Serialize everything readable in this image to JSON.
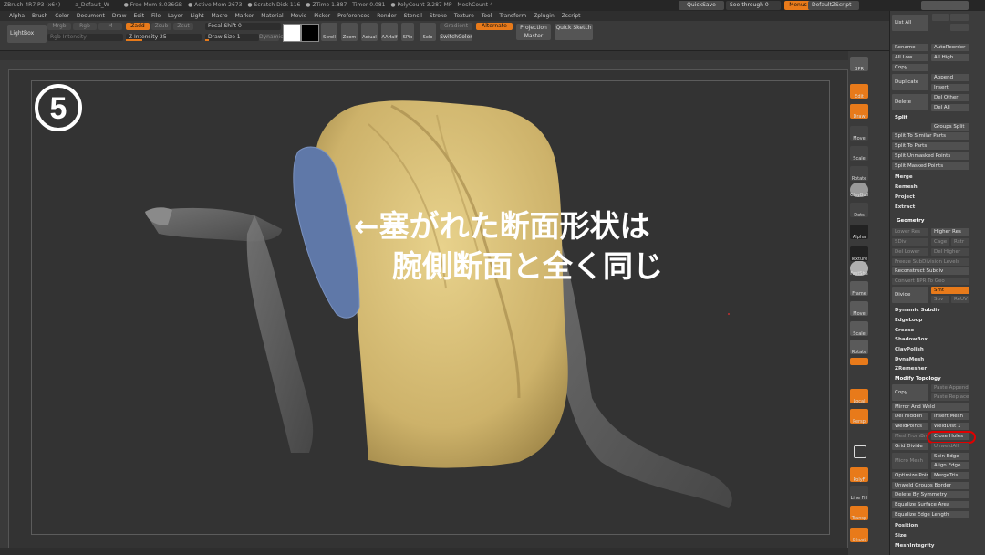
{
  "titlebar": {
    "app": "ZBrush 4R7 P3 (x64)",
    "doc": "a_Default_W",
    "free_mem": "● Free Mem 8.036GB",
    "active_mem": "● Active Mem 2673",
    "scratch": "● Scratch Disk 116",
    "ztime": "● ZTime 1.887",
    "timer": "Timer 0.081",
    "polycount": "● PolyCount 3.287 MP",
    "meshcount": "MeshCount 4",
    "quicksave": "QuickSave",
    "seethrough": "See-through 0",
    "menus": "Menus",
    "script": "DefaultZScript"
  },
  "menus": [
    "Alpha",
    "Brush",
    "Color",
    "Document",
    "Draw",
    "Edit",
    "File",
    "Layer",
    "Light",
    "Macro",
    "Marker",
    "Material",
    "Movie",
    "Picker",
    "Preferences",
    "Render",
    "Stencil",
    "Stroke",
    "Texture",
    "Tool",
    "Transform",
    "Zplugin",
    "Zscript"
  ],
  "toolbar": {
    "lightbox": "LightBox",
    "mrgb": "Mrgb",
    "rgb": "Rgb",
    "m": "M",
    "zadd": "Zadd",
    "zsub": "Zsub",
    "zcut": "Zcut",
    "rgb_intensity": "Rgb Intensity",
    "z_intensity": "Z Intensity 25",
    "focal_shift": "Focal Shift 0",
    "draw_size": "Draw Size 1",
    "dynamic": "Dynamic",
    "scroll": "Scroll",
    "zoom": "Zoom",
    "actual": "Actual",
    "aahalf": "AAHalf",
    "spix": "SPix",
    "gradient": "Gradient",
    "switchcolor": "SwitchColor",
    "alternate": "Alternate",
    "projection_master": "Projection Master",
    "quick_sketch": "Quick Sketch"
  },
  "canvas": {
    "step_number": "⑤",
    "caption_line1": "←塞がれた断面形状は",
    "caption_line2": "腕側断面と全く同じ"
  },
  "right_shelf": {
    "bpr": "BPR",
    "spix": "SPix 3",
    "edit": "Edit",
    "draw": "Draw",
    "move": "Move",
    "scale": "Scale",
    "rotate": "Rotate",
    "claybuild": "ClayBuil",
    "dots": "Dots",
    "alpha_off": "Alpha Off",
    "texture_off": "Texture Off",
    "fastshader": "FastSha",
    "frame": "Frame",
    "move2": "Move",
    "scale2": "Scale",
    "rotate2": "Rotate",
    "linefill": "Line Fill",
    "polyf": "PolyF",
    "local": "Local",
    "persp": "Persp",
    "floor": "Floor",
    "transp": "Transp",
    "ghost": "Ghost",
    "xyz": "Xyz",
    "solo": "Solo",
    "react": "React"
  },
  "palette": {
    "list_all": "List All",
    "rename": "Rename",
    "autoreorder": "AutoReorder",
    "all_low": "All Low",
    "all_high": "All High",
    "copy": "Copy",
    "duplicate": "Duplicate",
    "append": "Append",
    "insert": "Insert",
    "delete": "Delete",
    "del_other": "Del Other",
    "del_all": "Del All",
    "split": "Split",
    "groups_split": "Groups Split",
    "split_similar": "Split To Similar Parts",
    "split_parts": "Split To Parts",
    "split_unmasked": "Split Unmasked Points",
    "split_masked": "Split Masked Points",
    "merge": "Merge",
    "remesh": "Remesh",
    "project": "Project",
    "extract": "Extract",
    "geometry": "Geometry",
    "lower_res": "Lower Res",
    "higher_res": "Higher Res",
    "sdiv": "SDiv",
    "cage": "Cage",
    "rstr": "Rstr",
    "del_lower": "Del Lower",
    "del_higher": "Del Higher",
    "freeze_subdiv": "Freeze SubDivision Levels",
    "reconstruct": "Reconstruct Subdiv",
    "convert_bpr": "Convert BPR To Geo",
    "divide": "Divide",
    "smt": "Smt",
    "suv": "Suv",
    "reuv": "ReUV",
    "dynamic_subdiv": "Dynamic Subdiv",
    "edgeloop": "EdgeLoop",
    "crease": "Crease",
    "shadowbox": "ShadowBox",
    "claypolish": "ClayPolish",
    "dynamesh": "DynaMesh",
    "zremesher": "ZRemesher",
    "modify_topology": "Modify Topology",
    "copy2": "Copy",
    "paste_append": "Paste Append",
    "paste_replace": "Paste Replace",
    "mirror_weld": "Mirror And Weld",
    "del_hidden": "Del Hidden",
    "insert_mesh": "Insert Mesh",
    "weldpoints": "WeldPoints",
    "welddist": "WeldDist 1",
    "meshfrom_brush": "MeshFromBrush",
    "close_holes": "Close Holes",
    "grid_divide": "Grid Divide",
    "unweld": "UnweldAll",
    "micro_mesh": "Micro Mesh",
    "spin_edge": "Spin Edge",
    "align_edge": "Align Edge",
    "optimize_points": "Optimize Points",
    "merge_tris": "MergeTris",
    "unweld_groups": "Unweld Groups Border",
    "delete_symmetry": "Delete By Symmetry",
    "eq_surface": "Equalize Surface Area",
    "eq_edge": "Equalize Edge Length",
    "position": "Position",
    "size": "Size",
    "meshintegrity": "MeshIntegrity"
  },
  "colors": {
    "accent": "#e87a1a",
    "highlight_ring": "#e00000",
    "mesh_yellow": "#d8c079",
    "cap_blue": "#5f78a8"
  }
}
